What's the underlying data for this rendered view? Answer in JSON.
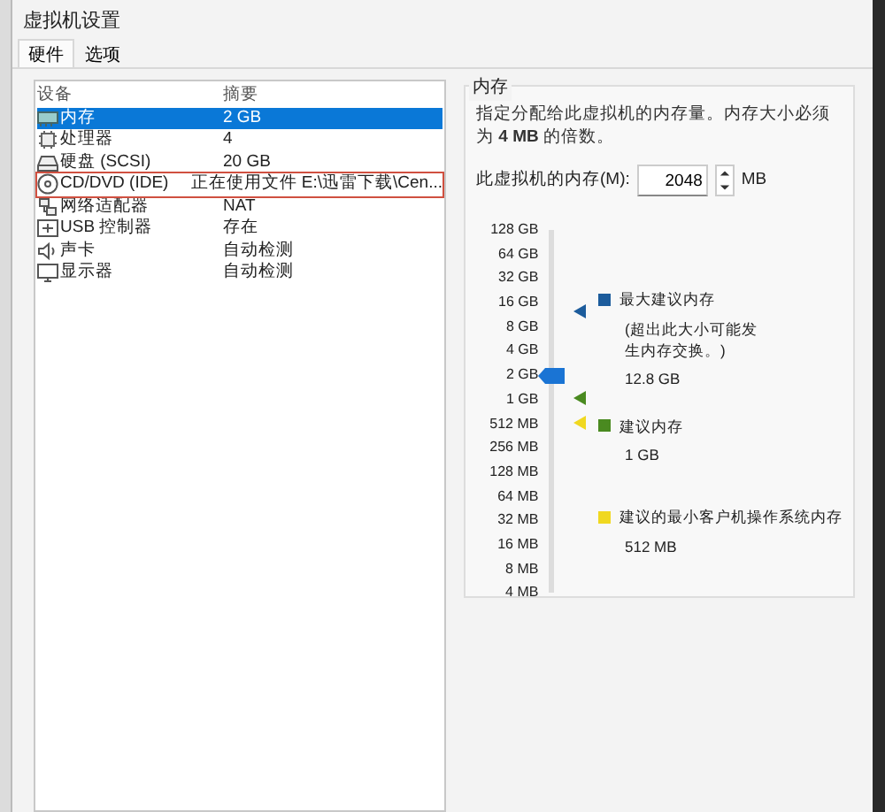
{
  "window": {
    "title": "虚拟机设置"
  },
  "tabs": [
    {
      "label": "硬件",
      "selected": true
    },
    {
      "label": "选项",
      "selected": false
    }
  ],
  "devices": {
    "columns": [
      "设备",
      "摘要"
    ],
    "rows": [
      {
        "kind": "memory",
        "device": "内存",
        "summary": "2 GB",
        "selected": true,
        "outlined": false
      },
      {
        "kind": "cpu",
        "device": "处理器",
        "summary": "4",
        "selected": false,
        "outlined": false
      },
      {
        "kind": "disk",
        "device": "硬盘 (SCSI)",
        "summary": "20 GB",
        "selected": false,
        "outlined": false
      },
      {
        "kind": "cdrom",
        "device": "CD/DVD (IDE)",
        "summary": "正在使用文件 E:\\迅雷下载\\Cen...",
        "selected": false,
        "outlined": true
      },
      {
        "kind": "network",
        "device": "网络适配器",
        "summary": "NAT",
        "selected": false,
        "outlined": false
      },
      {
        "kind": "usb",
        "device": "USB 控制器",
        "summary": "存在",
        "selected": false,
        "outlined": false
      },
      {
        "kind": "sound",
        "device": "声卡",
        "summary": "自动检测",
        "selected": false,
        "outlined": false
      },
      {
        "kind": "display",
        "device": "显示器",
        "summary": "自动检测",
        "selected": false,
        "outlined": false
      }
    ]
  },
  "memory": {
    "title": "内存",
    "description": "指定分配给此虚拟机的内存量。内存大小必须为 **4 MB** 的倍数。",
    "field_label": "此虚拟机的内存(M):",
    "value": "2048",
    "unit": "MB",
    "slider": {
      "ticks": [
        "128 GB",
        "64 GB",
        "32 GB",
        "16 GB",
        "8 GB",
        "4 GB",
        "2 GB",
        "1 GB",
        "512 MB",
        "256 MB",
        "128 MB",
        "64 MB",
        "32 MB",
        "16 MB",
        "8 MB",
        "4 MB"
      ],
      "level": 0.6,
      "markers": [
        {
          "color": "#1c5c9c",
          "level": 0.776
        },
        {
          "color": "#4a8a20",
          "level": 0.537
        },
        {
          "color": "#f0d820",
          "level": 0.468
        }
      ]
    },
    "legend": [
      {
        "color": "#1c5c9c",
        "label": "最大建议内存",
        "note": "(超出此大小可能发生内存交换。)",
        "value": "12.8 GB"
      },
      {
        "color": "#4a8a20",
        "label": "建议内存",
        "value": "1 GB"
      },
      {
        "color": "#f0d820",
        "label": "建议的最小客户机操作系统内存",
        "value": "512 MB"
      }
    ]
  }
}
